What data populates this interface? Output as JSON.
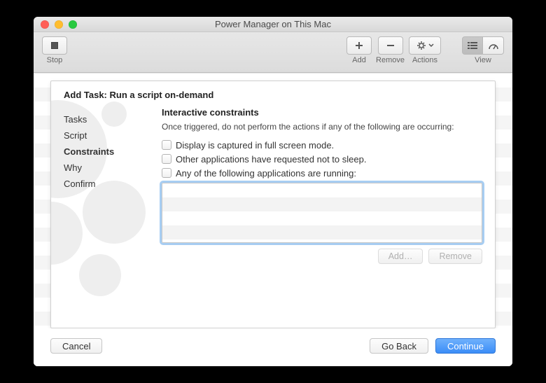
{
  "window": {
    "title": "Power Manager on This Mac"
  },
  "toolbar": {
    "stop": "Stop",
    "add": "Add",
    "remove": "Remove",
    "actions": "Actions",
    "view": "View"
  },
  "sheet": {
    "header": "Add Task: Run a script on-demand"
  },
  "sidebar": {
    "items": [
      {
        "label": "Tasks"
      },
      {
        "label": "Script"
      },
      {
        "label": "Constraints",
        "selected": true
      },
      {
        "label": "Why"
      },
      {
        "label": "Confirm"
      }
    ]
  },
  "panel": {
    "heading": "Interactive constraints",
    "desc": "Once triggered, do not perform the actions if any of the following are occurring:",
    "checks": [
      "Display is captured in full screen mode.",
      "Other applications have requested not to sleep.",
      "Any of the following applications are running:"
    ],
    "add_btn": "Add…",
    "remove_btn": "Remove"
  },
  "footer": {
    "cancel": "Cancel",
    "back": "Go Back",
    "continue": "Continue"
  }
}
